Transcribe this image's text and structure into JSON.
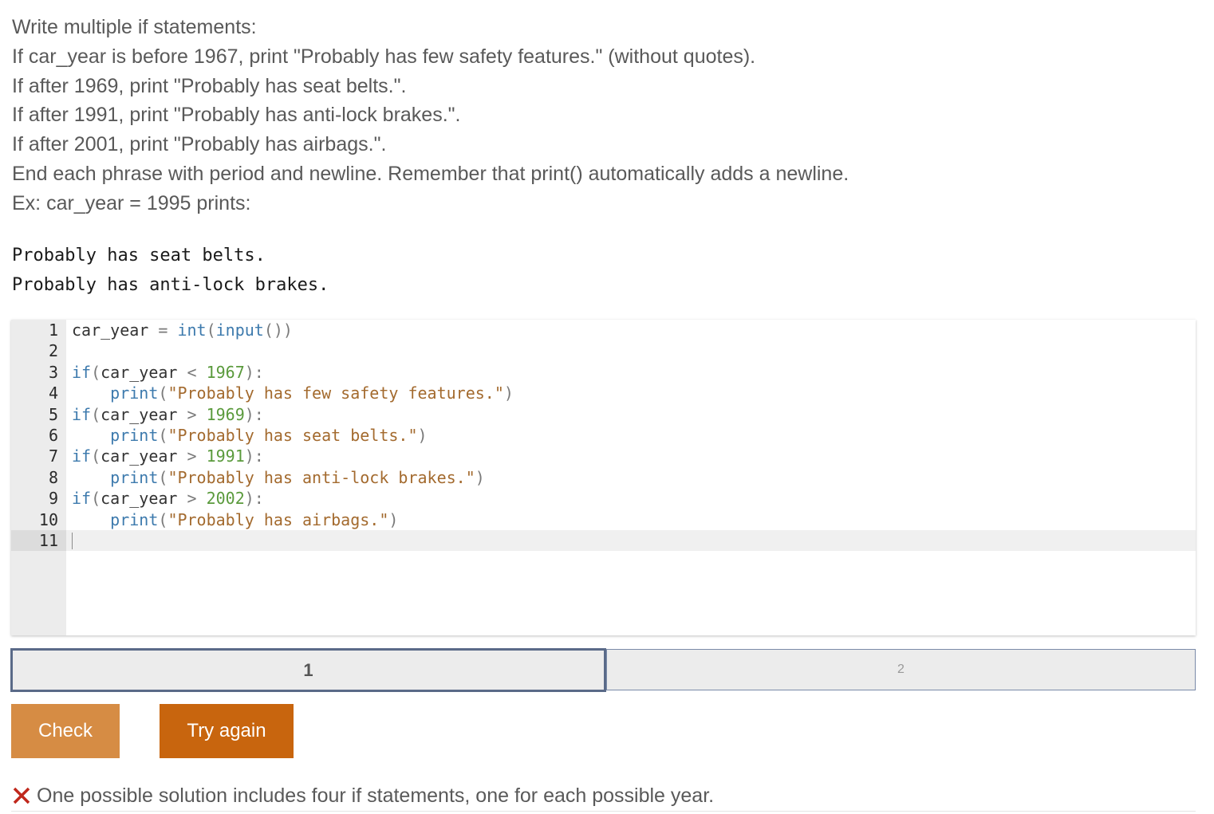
{
  "instructions": [
    "Write multiple if statements:",
    "If car_year is before 1967, print \"Probably has few safety features.\" (without quotes).",
    "If after 1969, print \"Probably has seat belts.\".",
    "If after 1991, print \"Probably has anti-lock brakes.\".",
    "If after 2001, print \"Probably has airbags.\".",
    "End each phrase with period and newline. Remember that print() automatically adds a newline.",
    "Ex: car_year = 1995 prints:"
  ],
  "sample_output": [
    "Probably has seat belts.",
    "Probably has anti-lock brakes."
  ],
  "editor": {
    "line_numbers": [
      "1",
      "2",
      "3",
      "4",
      "5",
      "6",
      "7",
      "8",
      "9",
      "10",
      "11"
    ],
    "lines": [
      [
        {
          "t": "car_year",
          "c": ""
        },
        {
          "t": " = ",
          "c": "op"
        },
        {
          "t": "int",
          "c": "kw"
        },
        {
          "t": "(",
          "c": "op"
        },
        {
          "t": "input",
          "c": "kw"
        },
        {
          "t": "())",
          "c": "op"
        }
      ],
      [],
      [
        {
          "t": "if",
          "c": "kw"
        },
        {
          "t": "(",
          "c": "op"
        },
        {
          "t": "car_year",
          "c": ""
        },
        {
          "t": " < ",
          "c": "op"
        },
        {
          "t": "1967",
          "c": "num"
        },
        {
          "t": "):",
          "c": "op"
        }
      ],
      [
        {
          "t": "    ",
          "c": ""
        },
        {
          "t": "print",
          "c": "kw"
        },
        {
          "t": "(",
          "c": "op"
        },
        {
          "t": "\"Probably has few safety features.\"",
          "c": "str"
        },
        {
          "t": ")",
          "c": "op"
        }
      ],
      [
        {
          "t": "if",
          "c": "kw"
        },
        {
          "t": "(",
          "c": "op"
        },
        {
          "t": "car_year",
          "c": ""
        },
        {
          "t": " > ",
          "c": "op"
        },
        {
          "t": "1969",
          "c": "num"
        },
        {
          "t": "):",
          "c": "op"
        }
      ],
      [
        {
          "t": "    ",
          "c": ""
        },
        {
          "t": "print",
          "c": "kw"
        },
        {
          "t": "(",
          "c": "op"
        },
        {
          "t": "\"Probably has seat belts.\"",
          "c": "str"
        },
        {
          "t": ")",
          "c": "op"
        }
      ],
      [
        {
          "t": "if",
          "c": "kw"
        },
        {
          "t": "(",
          "c": "op"
        },
        {
          "t": "car_year",
          "c": ""
        },
        {
          "t": " > ",
          "c": "op"
        },
        {
          "t": "1991",
          "c": "num"
        },
        {
          "t": "):",
          "c": "op"
        }
      ],
      [
        {
          "t": "    ",
          "c": ""
        },
        {
          "t": "print",
          "c": "kw"
        },
        {
          "t": "(",
          "c": "op"
        },
        {
          "t": "\"Probably has anti-lock brakes.\"",
          "c": "str"
        },
        {
          "t": ")",
          "c": "op"
        }
      ],
      [
        {
          "t": "if",
          "c": "kw"
        },
        {
          "t": "(",
          "c": "op"
        },
        {
          "t": "car_year",
          "c": ""
        },
        {
          "t": " > ",
          "c": "op"
        },
        {
          "t": "2002",
          "c": "num"
        },
        {
          "t": "):",
          "c": "op"
        }
      ],
      [
        {
          "t": "    ",
          "c": ""
        },
        {
          "t": "print",
          "c": "kw"
        },
        {
          "t": "(",
          "c": "op"
        },
        {
          "t": "\"Probably has airbags.\"",
          "c": "str"
        },
        {
          "t": ")",
          "c": "op"
        }
      ],
      []
    ]
  },
  "tabs": [
    {
      "label": "1",
      "active": true
    },
    {
      "label": "2",
      "active": false
    }
  ],
  "buttons": {
    "check": "Check",
    "try_again": "Try again"
  },
  "feedback": {
    "icon": "x-icon",
    "icon_color": "#c0281c",
    "message": "One possible solution includes four if statements, one for each possible year."
  },
  "colors": {
    "check_button": "#d68c44",
    "try_again_button": "#c8650e",
    "active_tab_border": "#5a6a88",
    "keyword": "#3d7aad",
    "number": "#5a9a3c",
    "string": "#a36a2e"
  }
}
